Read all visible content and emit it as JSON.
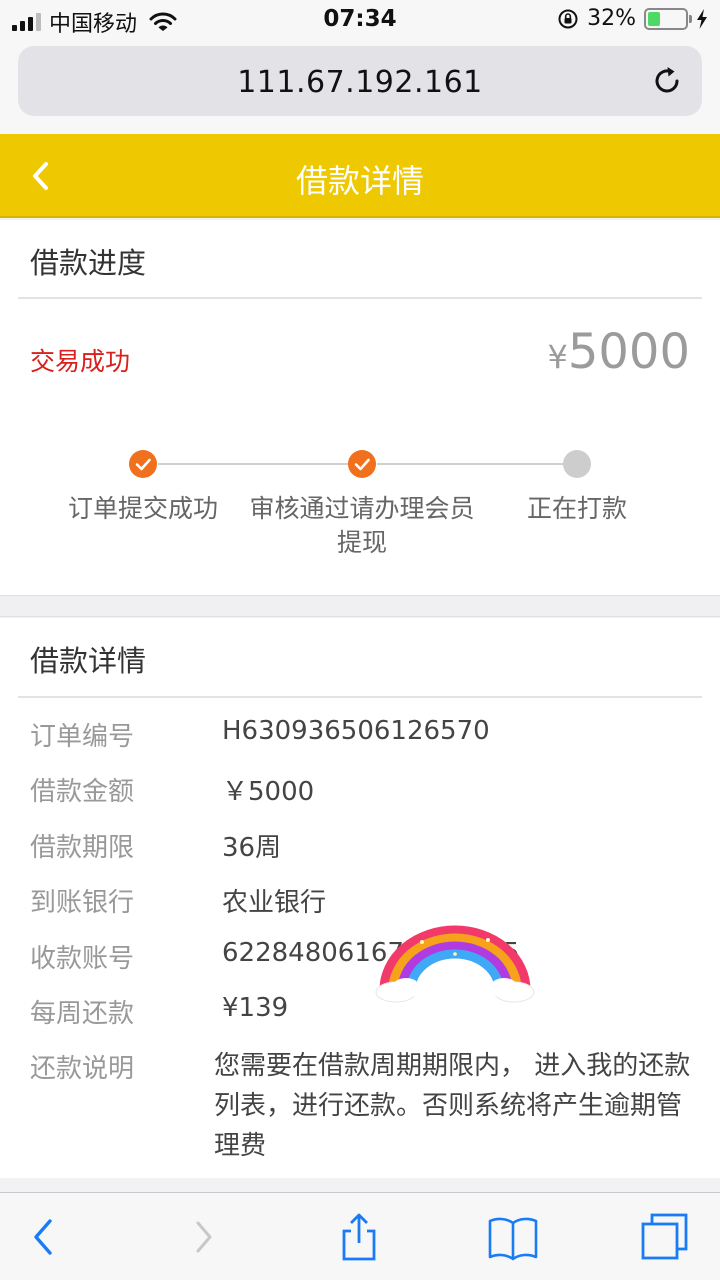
{
  "status_bar": {
    "carrier": "中国移动",
    "time": "07:34",
    "battery_percent": "32%",
    "battery_level": 0.32
  },
  "browser": {
    "url": "111.67.192.161"
  },
  "header": {
    "title": "借款详情"
  },
  "progress": {
    "section_title": "借款进度",
    "status": "交易成功",
    "currency": "¥",
    "amount": "5000",
    "steps": [
      {
        "label": "订单提交成功",
        "done": true
      },
      {
        "label": "审核通过请办理会员提现",
        "done": true
      },
      {
        "label": "正在打款",
        "done": false
      }
    ]
  },
  "detail": {
    "section_title": "借款详情",
    "rows": [
      {
        "label": "订单编号",
        "value": "H630936506126570"
      },
      {
        "label": "借款金额",
        "value": "￥5000"
      },
      {
        "label": "借款期限",
        "value": "36周"
      },
      {
        "label": "到账银行",
        "value": "农业银行"
      },
      {
        "label": "收款账号",
        "value": "62284806167          75"
      },
      {
        "label": "每周还款",
        "value": "¥139"
      }
    ],
    "note_label": "还款说明",
    "note_text": "您需要在借款周期期限内， 进入我的还款列表，进行还款。否则系统将产生逾期管理费"
  },
  "colors": {
    "header_bg": "#eec800",
    "status_red": "#d9201c",
    "step_done": "#f0701d",
    "step_todo": "#cdcdcd",
    "toolbar_blue": "#1a7cf5"
  },
  "icons": [
    "back-chevron-icon",
    "reload-icon",
    "check-icon",
    "share-icon",
    "bookmarks-icon",
    "tabs-icon",
    "rainbow-sticker"
  ]
}
